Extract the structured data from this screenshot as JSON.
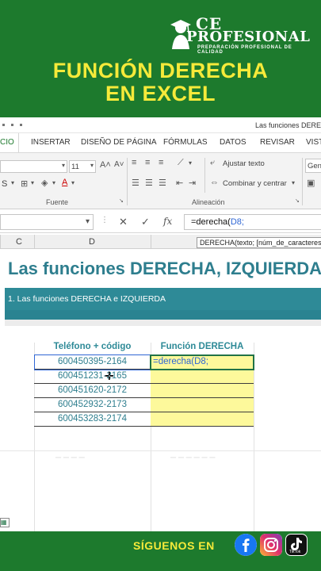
{
  "brand": {
    "line1": "CE",
    "line2": "PROFESIONAL",
    "tagline": "PREPARACIÓN PROFESIONAL DE CALIDAD"
  },
  "headline": {
    "line1": "FUNCIÓN DERECHA",
    "line2": "EN EXCEL"
  },
  "window": {
    "title": "Las funciones DERECH"
  },
  "ribbon_tabs": {
    "active": "CIO",
    "items": [
      "INSERTAR",
      "DISEÑO DE PÁGINA",
      "FÓRMULAS",
      "DATOS",
      "REVISAR",
      "VISTA"
    ]
  },
  "ribbon": {
    "font_size": "11",
    "font_label": "Fuente",
    "wrap_text": "Ajustar texto",
    "merge_center": "Combinar y centrar",
    "alignment_label": "Alineación",
    "number_format": "Gene"
  },
  "formula_bar": {
    "name_box": "",
    "fx": "fx",
    "formula_prefix": "=derecha(",
    "formula_ref": "D8;"
  },
  "columns": [
    "C",
    "D"
  ],
  "tooltip": "DERECHA(texto; [núm_de_caracteres])",
  "sheet": {
    "title": "Las funciones DERECHA, IZQUIERDA",
    "section": "1. Las funciones DERECHA e IZQUIERDA",
    "table": {
      "headers": [
        "Teléfono + código",
        "Función DERECHA"
      ],
      "rows": [
        [
          "600450395-2164",
          "=derecha(D8;"
        ],
        [
          "600451231-2165",
          ""
        ],
        [
          "600451620-2172",
          ""
        ],
        [
          "600452932-2173",
          ""
        ],
        [
          "600453283-2174",
          ""
        ]
      ]
    }
  },
  "footer": {
    "follow": "SÍGUENOS EN",
    "tiktok": "TikTok"
  },
  "colors": {
    "banner_green": "#1d7a2d",
    "headline_yellow": "#f6ea3a",
    "teal": "#2e8a97",
    "cell_yellow": "#fdf99b",
    "excel_green": "#217346"
  }
}
